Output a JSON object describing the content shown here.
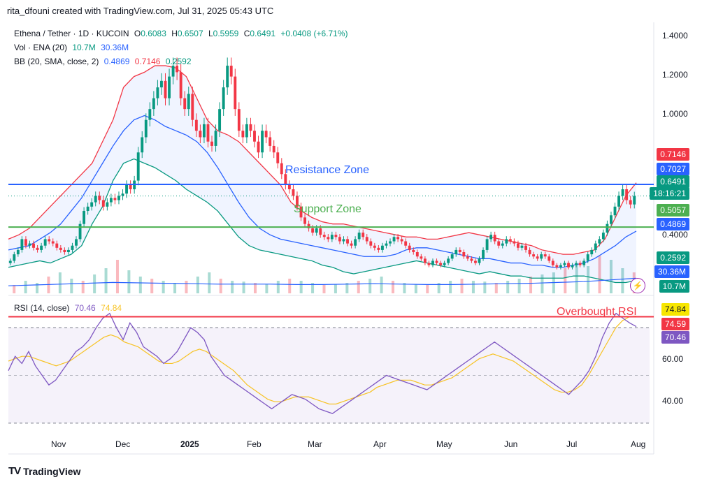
{
  "header": {
    "caption": "rita_dfouni created with TradingView.com, Jul 31, 2025 05:43 UTC"
  },
  "legend": {
    "symbol": "Ethena / Tether · 1D · KUCOIN",
    "o_label": "O",
    "o": "0.6083",
    "h_label": "H",
    "h": "0.6507",
    "l_label": "L",
    "l": "0.5959",
    "c_label": "C",
    "c": "0.6491",
    "change": "+0.0408 (+6.71%)",
    "vol_label": "Vol · ENA (20)",
    "vol_1": "10.7M",
    "vol_2": "30.36M",
    "bb_label": "BB (20, SMA, close, 2)",
    "bb_basis": "0.4869",
    "bb_upper": "0.7146",
    "bb_lower": "0.2592",
    "rsi_label": "RSI (14, close)",
    "rsi_value": "70.46",
    "rsi_ma": "74.84"
  },
  "price_axis_ticks": [
    "1.4000",
    "1.2000",
    "1.0000",
    "0.4000"
  ],
  "rsi_axis_ticks": [
    "60.00",
    "40.00"
  ],
  "price_labels": [
    {
      "text": "0.7146",
      "color": "#f23645"
    },
    {
      "text": "0.7027",
      "color": "#2962ff"
    },
    {
      "text": "0.6491",
      "color": "#089981"
    },
    {
      "text": "18:16:21",
      "color": "#089981"
    },
    {
      "text": "0.5057",
      "color": "#4caf50"
    },
    {
      "text": "0.4869",
      "color": "#2962ff"
    },
    {
      "text": "0.2592",
      "color": "#089981"
    },
    {
      "text": "30.36M",
      "color": "#2962ff"
    },
    {
      "text": "10.7M",
      "color": "#089981"
    }
  ],
  "rsi_labels": [
    {
      "text": "74.84",
      "color": "#f7e600",
      "fg": "#131722"
    },
    {
      "text": "74.59",
      "color": "#f23645",
      "fg": "#ffffff"
    },
    {
      "text": "70.46",
      "color": "#7e57c2",
      "fg": "#ffffff"
    }
  ],
  "annotations": {
    "resistance": "Resistance Zone",
    "support": "Support Zone",
    "overbought": "Overbought RSI"
  },
  "footer": {
    "brand": "TradingView",
    "logo": "TV"
  },
  "colors": {
    "up": "#089981",
    "down": "#f23645",
    "bb_upper": "#f23645",
    "bb_lower": "#089981",
    "bb_basis": "#2962ff",
    "rsi": "#7e57c2",
    "rsi_ma": "#f7c325",
    "resistance": "#2962ff",
    "support": "#4caf50"
  },
  "chart_data": {
    "type": "candlestick",
    "title": "Ethena / Tether · 1D · KUCOIN",
    "x_labels": [
      "Nov",
      "Dec",
      "2025",
      "Feb",
      "Mar",
      "Apr",
      "May",
      "Jun",
      "Jul",
      "Aug"
    ],
    "ylim": [
      0.2,
      1.45
    ],
    "resistance_level": 0.7027,
    "support_level": 0.5057,
    "last": {
      "open": 0.6083,
      "high": 0.6507,
      "low": 0.5959,
      "close": 0.6491
    },
    "closes": [
      0.35,
      0.38,
      0.4,
      0.45,
      0.42,
      0.43,
      0.41,
      0.4,
      0.42,
      0.45,
      0.44,
      0.43,
      0.41,
      0.4,
      0.39,
      0.4,
      0.42,
      0.45,
      0.52,
      0.58,
      0.6,
      0.62,
      0.65,
      0.63,
      0.6,
      0.62,
      0.64,
      0.63,
      0.65,
      0.66,
      0.7,
      0.68,
      0.72,
      0.85,
      0.92,
      1.0,
      1.05,
      1.1,
      1.15,
      1.18,
      1.1,
      1.2,
      1.25,
      1.22,
      1.1,
      1.05,
      1.12,
      1.0,
      0.95,
      0.92,
      0.98,
      0.9,
      0.88,
      0.95,
      1.05,
      1.15,
      1.25,
      1.2,
      1.05,
      0.95,
      0.92,
      0.98,
      0.95,
      0.9,
      0.85,
      0.95,
      0.92,
      0.88,
      0.85,
      0.8,
      0.75,
      0.7,
      0.68,
      0.65,
      0.6,
      0.55,
      0.52,
      0.5,
      0.48,
      0.5,
      0.47,
      0.46,
      0.45,
      0.47,
      0.46,
      0.44,
      0.45,
      0.43,
      0.42,
      0.45,
      0.48,
      0.46,
      0.44,
      0.42,
      0.41,
      0.4,
      0.42,
      0.43,
      0.44,
      0.46,
      0.45,
      0.44,
      0.42,
      0.4,
      0.39,
      0.37,
      0.36,
      0.34,
      0.33,
      0.35,
      0.34,
      0.33,
      0.34,
      0.36,
      0.38,
      0.4,
      0.39,
      0.37,
      0.36,
      0.35,
      0.34,
      0.36,
      0.4,
      0.45,
      0.47,
      0.44,
      0.42,
      0.43,
      0.45,
      0.44,
      0.43,
      0.41,
      0.42,
      0.4,
      0.38,
      0.37,
      0.36,
      0.38,
      0.37,
      0.35,
      0.33,
      0.32,
      0.33,
      0.34,
      0.32,
      0.33,
      0.34,
      0.33,
      0.35,
      0.38,
      0.4,
      0.43,
      0.45,
      0.48,
      0.52,
      0.56,
      0.6,
      0.65,
      0.68,
      0.63,
      0.61,
      0.6491
    ],
    "bb_upper": [
      0.45,
      0.47,
      0.5,
      0.55,
      0.6,
      0.65,
      0.7,
      0.75,
      0.8,
      0.9,
      1.0,
      1.15,
      1.2,
      1.22,
      1.25,
      1.25,
      1.24,
      1.2,
      1.1,
      1.0,
      0.95,
      0.93,
      0.9,
      0.85,
      0.8,
      0.75,
      0.7,
      0.62,
      0.58,
      0.55,
      0.53,
      0.52,
      0.52,
      0.51,
      0.5,
      0.49,
      0.48,
      0.47,
      0.46,
      0.46,
      0.45,
      0.45,
      0.46,
      0.47,
      0.48,
      0.47,
      0.46,
      0.45,
      0.44,
      0.43,
      0.42,
      0.4,
      0.39,
      0.38,
      0.38,
      0.39,
      0.4,
      0.45,
      0.55,
      0.65,
      0.71
    ],
    "bb_basis": [
      0.4,
      0.41,
      0.42,
      0.45,
      0.48,
      0.52,
      0.58,
      0.64,
      0.72,
      0.8,
      0.88,
      0.95,
      1.0,
      1.02,
      1.0,
      0.97,
      0.95,
      0.93,
      0.9,
      0.85,
      0.78,
      0.7,
      0.62,
      0.55,
      0.5,
      0.47,
      0.45,
      0.44,
      0.43,
      0.42,
      0.41,
      0.4,
      0.39,
      0.38,
      0.37,
      0.37,
      0.37,
      0.38,
      0.4,
      0.41,
      0.41,
      0.4,
      0.39,
      0.38,
      0.37,
      0.36,
      0.36,
      0.35,
      0.34,
      0.34,
      0.33,
      0.33,
      0.32,
      0.32,
      0.33,
      0.34,
      0.36,
      0.39,
      0.42,
      0.46,
      0.4869
    ],
    "bb_lower": [
      0.32,
      0.33,
      0.34,
      0.35,
      0.34,
      0.36,
      0.38,
      0.42,
      0.52,
      0.6,
      0.72,
      0.8,
      0.82,
      0.8,
      0.78,
      0.75,
      0.72,
      0.68,
      0.65,
      0.62,
      0.58,
      0.52,
      0.46,
      0.42,
      0.4,
      0.39,
      0.38,
      0.37,
      0.36,
      0.35,
      0.33,
      0.32,
      0.3,
      0.29,
      0.3,
      0.31,
      0.32,
      0.33,
      0.34,
      0.35,
      0.34,
      0.33,
      0.32,
      0.31,
      0.3,
      0.29,
      0.3,
      0.29,
      0.28,
      0.28,
      0.27,
      0.27,
      0.27,
      0.27,
      0.28,
      0.28,
      0.27,
      0.26,
      0.25,
      0.25,
      0.2592
    ],
    "rsi": [
      52,
      58,
      55,
      60,
      54,
      50,
      46,
      48,
      52,
      56,
      60,
      62,
      65,
      70,
      74,
      76,
      70,
      65,
      72,
      68,
      62,
      60,
      58,
      55,
      57,
      60,
      65,
      70,
      68,
      65,
      58,
      54,
      50,
      48,
      46,
      44,
      42,
      40,
      38,
      36,
      38,
      40,
      42,
      41,
      40,
      38,
      36,
      35,
      34,
      36,
      38,
      40,
      42,
      44,
      46,
      48,
      50,
      49,
      48,
      47,
      46,
      45,
      44,
      46,
      48,
      50,
      52,
      54,
      56,
      58,
      60,
      62,
      64,
      62,
      60,
      58,
      56,
      54,
      52,
      50,
      48,
      46,
      44,
      42,
      45,
      48,
      52,
      58,
      66,
      72,
      76,
      74,
      72,
      70.46
    ],
    "rsi_ma": [
      56,
      57,
      58,
      58,
      57,
      56,
      55,
      54,
      55,
      56,
      58,
      60,
      62,
      64,
      66,
      67,
      66,
      64,
      63,
      62,
      60,
      58,
      56,
      55,
      55,
      56,
      58,
      60,
      61,
      60,
      58,
      56,
      54,
      52,
      49,
      46,
      44,
      42,
      40,
      39,
      39,
      40,
      41,
      41,
      41,
      40,
      39,
      38,
      38,
      39,
      40,
      41,
      42,
      43,
      45,
      46,
      47,
      48,
      48,
      48,
      47,
      46,
      46,
      47,
      48,
      49,
      51,
      53,
      55,
      57,
      58,
      59,
      58,
      57,
      56,
      54,
      52,
      50,
      48,
      46,
      44,
      43,
      43,
      44,
      46,
      50,
      55,
      60,
      65,
      70,
      73,
      74.59,
      74.84
    ],
    "volume": [
      0.2,
      0.3,
      0.25,
      0.4,
      0.5,
      0.35,
      0.3,
      0.45,
      0.6,
      0.8,
      0.55,
      0.4,
      0.35,
      0.3,
      0.25,
      0.3,
      0.4,
      0.5,
      0.35,
      0.3,
      0.28,
      0.25,
      0.22,
      0.3,
      0.35,
      0.3,
      0.25,
      0.2,
      0.22,
      0.25,
      0.3,
      0.35,
      0.4,
      0.3,
      0.25,
      0.22,
      0.2,
      0.25,
      0.3,
      0.35,
      0.3,
      0.28,
      0.25,
      0.3,
      0.35,
      0.4,
      0.45,
      0.5,
      0.6,
      0.7,
      0.65,
      0.9,
      0.8,
      0.6,
      0.5
    ]
  }
}
